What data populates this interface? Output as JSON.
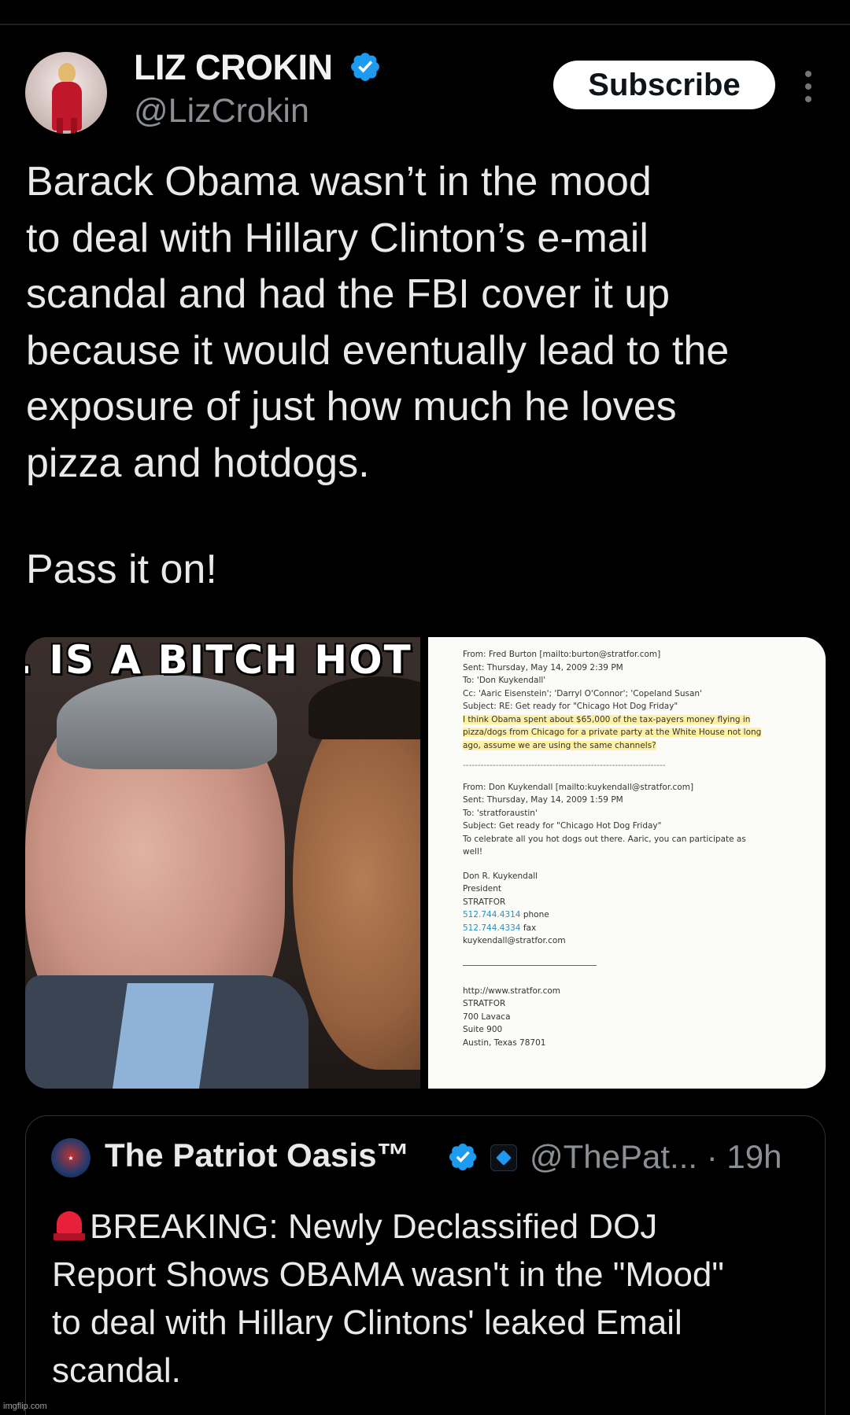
{
  "post": {
    "author_name": "LIZ CROKIN",
    "author_handle": "@LizCrokin",
    "subscribe_label": "Subscribe",
    "text_lines": [
      "Barack Obama wasn’t in the mood",
      "to deal with Hillary Clinton’s e-mail",
      "scandal and had the FBI cover it up",
      "because it would eventually lead to the",
      "exposure of just how much he loves",
      "pizza and hotdogs."
    ],
    "text_final": "Pass it on!"
  },
  "media": {
    "meme_caption": ". IS A BITCH HOT",
    "email": {
      "block1": [
        "From: Fred Burton [mailto:burton@stratfor.com]",
        "Sent: Thursday, May 14, 2009 2:39 PM",
        "To: 'Don Kuykendall'",
        "Cc: 'Aaric Eisenstein'; 'Darryl O'Connor'; 'Copeland Susan'",
        "Subject: RE: Get ready for \"Chicago Hot Dog Friday\""
      ],
      "highlight": [
        "I think Obama spent about $65,000 of the tax-payers money flying in",
        "pizza/dogs from Chicago for a private party at the White House not long",
        "ago, assume we are using the same channels?"
      ],
      "divider": "--------------------------------------------------------------------",
      "block2": [
        "From: Don Kuykendall [mailto:kuykendall@stratfor.com]",
        "Sent: Thursday, May 14, 2009 1:59 PM",
        "To: 'stratforaustin'",
        "Subject: Get ready for \"Chicago Hot Dog Friday\"",
        "To celebrate all you hot dogs out there. Aaric, you can participate as",
        "well!"
      ],
      "signature": {
        "name": "Don R. Kuykendall",
        "title": "President",
        "company": "STRATFOR",
        "phone_number": "512.744.4314",
        "phone_label": " phone",
        "fax_number": "512.744.4334",
        "fax_label": " fax",
        "email": "kuykendall@stratfor.com"
      },
      "address": [
        "http://www.stratfor.com",
        "STRATFOR",
        "700 Lavaca",
        "Suite 900",
        "Austin, Texas 78701"
      ]
    }
  },
  "quote": {
    "name": "The Patriot Oasis™",
    "handle_time": "@ThePat... · 19h",
    "text_lines": [
      "BREAKING: Newly Declassified DOJ",
      "Report Shows OBAMA wasn't in the \"Mood\"",
      "to deal with Hillary Clintons' leaked Email",
      "scandal."
    ]
  },
  "watermark": "imgflip.com",
  "colors": {
    "background": "#000000",
    "text": "#e7e9ea",
    "muted": "#8b8f93",
    "verified": "#1d9bf0",
    "highlight": "#ffeb78"
  },
  "icons": [
    "verified-badge-icon",
    "more-options-icon",
    "siren-emoji-icon",
    "organization-badge-icon"
  ]
}
